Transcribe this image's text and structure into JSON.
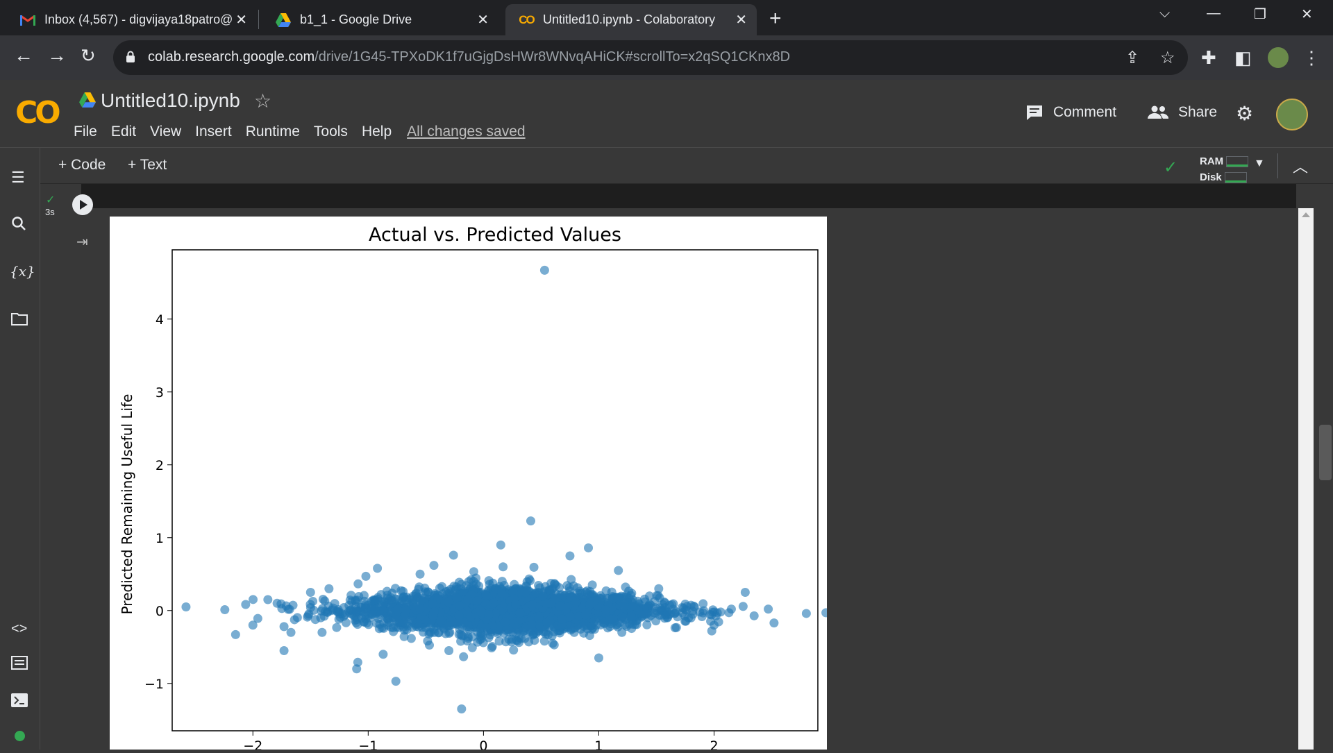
{
  "browser": {
    "tabs": [
      {
        "title": "Inbox (4,567) - digvijaya18patro@",
        "icon": "gmail-icon"
      },
      {
        "title": "b1_1 - Google Drive",
        "icon": "drive-icon"
      },
      {
        "title": "Untitled10.ipynb - Colaboratory",
        "icon": "colab-icon",
        "active": true
      }
    ],
    "url_host": "colab.research.google.com",
    "url_path": "/drive/1G45-TPXoDK1f7uGjgDsHWr8WNvqAHiCK#scrollTo=x2qSQ1CKnx8D"
  },
  "colab": {
    "logo": "CO",
    "notebook_title": "Untitled10.ipynb",
    "menu": [
      "File",
      "Edit",
      "View",
      "Insert",
      "Runtime",
      "Tools",
      "Help"
    ],
    "saved_status": "All changes saved",
    "comment_label": "Comment",
    "share_label": "Share",
    "add_code": "+ Code",
    "add_text": "+ Text",
    "ram_label": "RAM",
    "disk_label": "Disk",
    "cell_exec_time": "3s"
  },
  "colors": {
    "accent": "#f9ab00",
    "point": "#1f77b4",
    "ok": "#34a853"
  },
  "chart_data": {
    "type": "scatter",
    "title": "Actual vs. Predicted Values",
    "xlabel": "",
    "ylabel": "Predicted Remaining Useful Life",
    "xlim": [
      -2.7,
      2.9
    ],
    "ylim": [
      -1.65,
      4.95
    ],
    "xticks": [
      -2,
      -1,
      0,
      1,
      2
    ],
    "yticks": [
      -1,
      0,
      1,
      2,
      3,
      4
    ],
    "xtick_labels": [
      "−2",
      "−1",
      "0",
      "1",
      "2"
    ],
    "ytick_labels": [
      "−1",
      "0",
      "1",
      "2",
      "3",
      "4"
    ],
    "point_alpha": 0.6,
    "dense_cluster": {
      "description_note": "thousands of points",
      "x_center": 0.2,
      "y_center": 0.0,
      "x_spread": 0.65,
      "y_spread": 0.18
    },
    "points": [
      [
        0.53,
        4.67
      ],
      [
        0.41,
        1.23
      ],
      [
        0.15,
        0.9
      ],
      [
        0.91,
        0.86
      ],
      [
        -0.26,
        0.76
      ],
      [
        0.75,
        0.75
      ],
      [
        -0.92,
        0.58
      ],
      [
        -1.02,
        0.47
      ],
      [
        -0.43,
        0.62
      ],
      [
        1.17,
        0.55
      ],
      [
        -1.34,
        0.3
      ],
      [
        -2.58,
        0.05
      ],
      [
        -2.15,
        -0.33
      ],
      [
        -1.87,
        0.15
      ],
      [
        -1.79,
        0.1
      ],
      [
        -1.67,
        -0.3
      ],
      [
        -1.73,
        -0.22
      ],
      [
        -1.73,
        -0.55
      ],
      [
        2.27,
        0.25
      ],
      [
        2.47,
        0.02
      ],
      [
        2.52,
        -0.17
      ],
      [
        2.8,
        -0.04
      ],
      [
        2.97,
        -0.03
      ],
      [
        1.99,
        0.01
      ],
      [
        1.98,
        -0.28
      ],
      [
        1.83,
        0.05
      ],
      [
        2.0,
        -0.2
      ],
      [
        1.0,
        -0.65
      ],
      [
        -0.76,
        -0.97
      ],
      [
        -1.09,
        -0.71
      ],
      [
        -1.1,
        -0.8
      ],
      [
        -0.87,
        -0.6
      ],
      [
        -0.19,
        -1.35
      ],
      [
        1.52,
        0.3
      ],
      [
        1.44,
        0.2
      ],
      [
        0.17,
        0.6
      ],
      [
        -0.55,
        0.5
      ],
      [
        1.8,
        -0.1
      ],
      [
        -1.4,
        -0.3
      ],
      [
        1.2,
        -0.3
      ],
      [
        -0.3,
        -0.55
      ],
      [
        0.6,
        -0.45
      ],
      [
        -1.5,
        0.25
      ],
      [
        2.15,
        0.02
      ],
      [
        -2.0,
        -0.2
      ]
    ]
  }
}
